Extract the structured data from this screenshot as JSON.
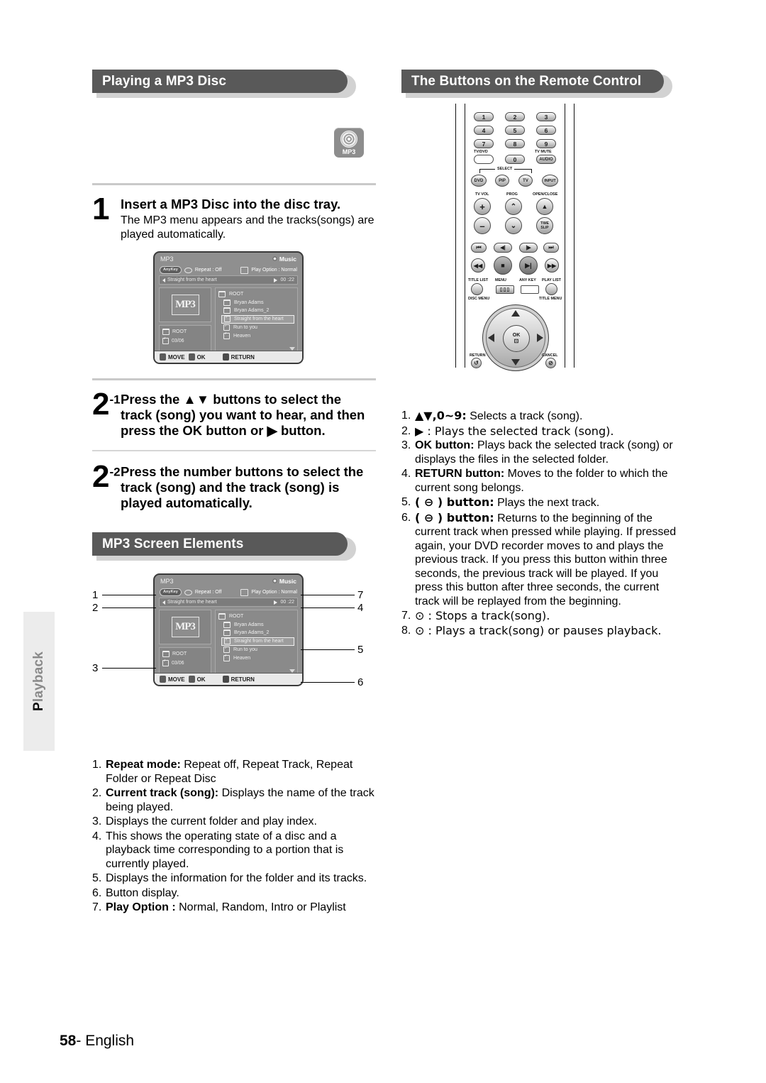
{
  "page": {
    "number": "58",
    "language": "English",
    "side_tab": "Playback"
  },
  "sections": {
    "playing_mp3": "Playing a MP3 Disc",
    "screen_elements": "MP3 Screen Elements",
    "remote_buttons": "The Buttons on the Remote Control"
  },
  "disc_badge": {
    "label": "MP3"
  },
  "steps": [
    {
      "num": "1",
      "sup": "",
      "title": "Insert a MP3 Disc into the disc tray.",
      "desc": "The MP3 menu appears and the tracks(songs) are played automatically."
    },
    {
      "num": "2",
      "sup": "-1",
      "title": "Press the ▲▼ buttons to select the track (song) you want to hear, and then press the OK button or ▶ button.",
      "desc": ""
    },
    {
      "num": "2",
      "sup": "-2",
      "title": "Press the number buttons to select the track (song) and the track (song) is played automatically.",
      "desc": ""
    }
  ],
  "osd": {
    "title": "MP3",
    "mode": "Music",
    "anykey": "AnyKey",
    "repeat": "Repeat : Off",
    "play_option": "Play Option : Normal",
    "now_playing": "Straight from the heart",
    "time": "00 :22",
    "art_label": "MP3",
    "info_folder": "ROOT",
    "info_index": "03/06",
    "items": [
      {
        "label": "ROOT",
        "type": "root",
        "selected": false
      },
      {
        "label": "Bryan Adams",
        "type": "folder",
        "selected": false
      },
      {
        "label": "Bryan Adams_2",
        "type": "folder",
        "selected": false
      },
      {
        "label": "Straight from the heart",
        "type": "track",
        "selected": true
      },
      {
        "label": "Run to you",
        "type": "track",
        "selected": false
      },
      {
        "label": "Heaven",
        "type": "track",
        "selected": false
      }
    ],
    "buttons": {
      "move": "MOVE",
      "ok": "OK",
      "return": "RETURN"
    }
  },
  "callouts": {
    "c1": "1",
    "c2": "2",
    "c3": "3",
    "c4": "4",
    "c5": "5",
    "c6": "6",
    "c7": "7"
  },
  "screen_elements_list": [
    {
      "idx": "1.",
      "bold": "Repeat mode:",
      "text": " Repeat off, Repeat Track, Repeat Folder or Repeat Disc"
    },
    {
      "idx": "2.",
      "bold": "Current track (song):",
      "text": " Displays the name of the track being played."
    },
    {
      "idx": "3.",
      "bold": "",
      "text": "Displays the current folder and play index."
    },
    {
      "idx": "4.",
      "bold": "",
      "text": "This shows the operating state of a disc and a playback time corresponding to a portion that is currently played."
    },
    {
      "idx": "5.",
      "bold": "",
      "text": "Displays the information for the folder and its tracks."
    },
    {
      "idx": "6.",
      "bold": "",
      "text": "Button display."
    },
    {
      "idx": "7.",
      "bold": "Play Option :",
      "text": " Normal, Random, Intro or Playlist"
    }
  ],
  "remote_list": [
    {
      "idx": "1.",
      "bold": "▲▼,0~9:",
      "text": " Selects a track (song)."
    },
    {
      "idx": "2.",
      "bold": "",
      "text": "▶ : Plays the selected track (song)."
    },
    {
      "idx": "3.",
      "bold": "OK button:",
      "text": " Plays back the selected track (song) or displays the files in the selected folder."
    },
    {
      "idx": "4.",
      "bold": "RETURN button:",
      "text": " Moves to the folder to which the current song belongs."
    },
    {
      "idx": "5.",
      "bold": "( ⊖ ) button:",
      "text": " Plays the next track."
    },
    {
      "idx": "6.",
      "bold": "( ⊖ ) button:",
      "text": " Returns to the beginning of the current track when pressed while playing. If pressed again, your DVD recorder moves to and plays the previous track. If you press this button within three seconds, the previous track will be played. If you press this button after three seconds, the current track will be replayed from the beginning."
    },
    {
      "idx": "7.",
      "bold": "",
      "text": "⊙ : Stops a track(song)."
    },
    {
      "idx": "8.",
      "bold": "",
      "text": "⊙ : Plays a track(song) or pauses playback."
    }
  ],
  "remote": {
    "numbers": [
      "1",
      "2",
      "3",
      "4",
      "5",
      "6",
      "7",
      "8",
      "9",
      "0"
    ],
    "tv_dvd": "TV/DVD",
    "tv_mute": "TV MUTE",
    "audio": "AUDIO",
    "select": "SELECT",
    "select_keys": [
      "DVD",
      "PIP",
      "TV",
      "INPUT"
    ],
    "tv_vol": "TV VOL",
    "prog": "PROG",
    "open_close": "OPEN/CLOSE",
    "plus": "+",
    "minus": "–",
    "time_slip": "TIME SLIP",
    "title_list": "TITLE LIST",
    "menu": "MENU",
    "any_key": "ANY KEY",
    "play_list": "PLAY LIST",
    "disc_menu": "DISC MENU",
    "title_menu": "TITLE MENU",
    "ok": "OK",
    "return": "RETURN",
    "cancel": "CANCEL"
  }
}
